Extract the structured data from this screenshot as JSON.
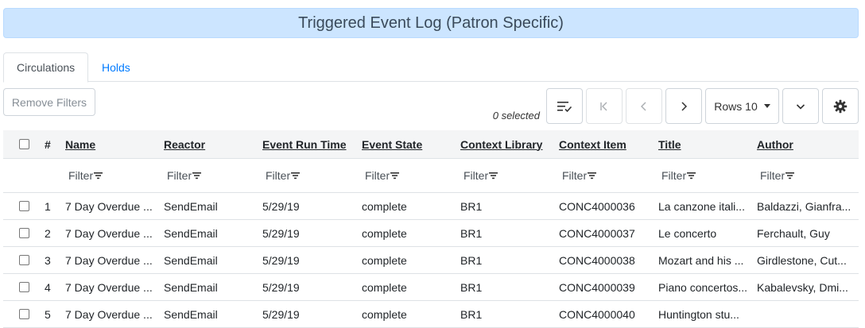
{
  "banner": {
    "title": "Triggered Event Log (Patron Specific)"
  },
  "tabs": [
    {
      "label": "Circulations",
      "active": true
    },
    {
      "label": "Holds",
      "active": false
    }
  ],
  "toolbar": {
    "remove_filters_label": "Remove Filters",
    "selected_text": "0 selected",
    "rows_label": "Rows 10",
    "icons": [
      "column-select-icon",
      "first-page-icon",
      "prev-page-icon",
      "next-page-icon",
      "chevron-down-icon",
      "gear-icon"
    ]
  },
  "table": {
    "num_header": "#",
    "columns": [
      "Name",
      "Reactor",
      "Event Run Time",
      "Event State",
      "Context Library",
      "Context Item",
      "Title",
      "Author"
    ],
    "filter_label": "Filter",
    "rows": [
      {
        "num": "1",
        "name": "7 Day Overdue ...",
        "reactor": "SendEmail",
        "run_time": "5/29/19",
        "state": "complete",
        "library": "BR1",
        "item": "CONC4000036",
        "title": "La canzone itali...",
        "author": "Baldazzi, Gianfra..."
      },
      {
        "num": "2",
        "name": "7 Day Overdue ...",
        "reactor": "SendEmail",
        "run_time": "5/29/19",
        "state": "complete",
        "library": "BR1",
        "item": "CONC4000037",
        "title": "Le concerto",
        "author": "Ferchault, Guy"
      },
      {
        "num": "3",
        "name": "7 Day Overdue ...",
        "reactor": "SendEmail",
        "run_time": "5/29/19",
        "state": "complete",
        "library": "BR1",
        "item": "CONC4000038",
        "title": "Mozart and his ...",
        "author": "Girdlestone, Cut..."
      },
      {
        "num": "4",
        "name": "7 Day Overdue ...",
        "reactor": "SendEmail",
        "run_time": "5/29/19",
        "state": "complete",
        "library": "BR1",
        "item": "CONC4000039",
        "title": "Piano concertos...",
        "author": "Kabalevsky, Dmi..."
      },
      {
        "num": "5",
        "name": "7 Day Overdue ...",
        "reactor": "SendEmail",
        "run_time": "5/29/19",
        "state": "complete",
        "library": "BR1",
        "item": "CONC4000040",
        "title": "Huntington stu...",
        "author": ""
      }
    ]
  }
}
